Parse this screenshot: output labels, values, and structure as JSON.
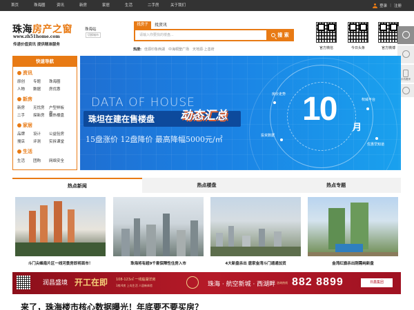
{
  "topbar": {
    "nav": [
      "首页",
      "珠海圈",
      "资讯",
      "新房",
      "家居",
      "生活",
      "二手房",
      "关于我们"
    ],
    "login": "登录",
    "register": "注册"
  },
  "header": {
    "logo_a": "珠海",
    "logo_b": "房产之窗",
    "logo_url": "www.zh51home.com",
    "slogan": "传递价值资讯 提供精准服务",
    "city": "珠海站",
    "city_switch": "切换城市"
  },
  "search": {
    "tab_active": "找房子",
    "tab_other": "找资讯",
    "placeholder": "请输入你要找的楼盘...",
    "button": "搜 索",
    "hot_label": "热搜:",
    "hot_terms": [
      "佳源印象西湖",
      "中海桐聖广场",
      "天地源·上善府"
    ]
  },
  "qrcodes": [
    "官方微信",
    "今日头条",
    "官方微博"
  ],
  "sidebar_float": {
    "item3_caption": "手机看房"
  },
  "quick_nav": {
    "title": "快速导航",
    "sections": [
      {
        "name": "资讯",
        "rows": [
          [
            "原创",
            "专题",
            "珠海圈"
          ],
          [
            "人物",
            "数据",
            "房优惠"
          ]
        ]
      },
      {
        "name": "新房",
        "rows": [
          [
            "新房",
            "无忧房",
            "户型样板房"
          ],
          [
            "二手",
            "探新房",
            "最热楼盘"
          ]
        ]
      },
      {
        "name": "家居",
        "rows": [
          [
            "品牌",
            "设计",
            "公益验房"
          ],
          [
            "搜店",
            "评测",
            "实拆课堂"
          ]
        ]
      },
      {
        "name": "生活",
        "rows": [
          [
            "生活",
            "团购",
            "网络安全"
          ]
        ]
      }
    ]
  },
  "banner": {
    "en_title": "DATA OF HOUSE",
    "title": "珠坦在建在售楼盘",
    "tag": "动态汇总",
    "subtitle": "15盘涨价 12盘降价 最高降幅5000元/㎡",
    "big_number": "10",
    "month": "月",
    "labels": [
      "房价走势",
      "权威平台",
      "投资数据",
      "优惠早知道"
    ],
    "active_dot": 2
  },
  "tabs": [
    {
      "label": "热点新闻",
      "active": true
    },
    {
      "label": "热点楼盘",
      "active": false
    },
    {
      "label": "热点专题",
      "active": false
    }
  ],
  "cards": [
    {
      "caption": "斗门尖峰南片区一线河景房即将面市！"
    },
    {
      "caption": "珠海将有超9千套保障性住房入市"
    },
    {
      "caption": "4大新盘杀出 唐家金湾斗门通通加货"
    },
    {
      "caption": "金湾红旗杀出刚需纯新盘"
    }
  ],
  "ad": {
    "brand_a": "润昌盛境",
    "brand_b": "开工在即",
    "area": "108-123㎡ 一线临湖洋房",
    "small": "3房/4房 上岛生活 人居新体验",
    "right_title": "珠海 · 航空新城 · 西湖畔",
    "phone_label": "咨询热线",
    "phone": "882 8899",
    "developer": "日鑫集团"
  },
  "headline": "来了，珠海楼市核心数据曝光！年底要不要买房？",
  "colors": {
    "accent": "#e87a14",
    "topbar": "#333333"
  }
}
